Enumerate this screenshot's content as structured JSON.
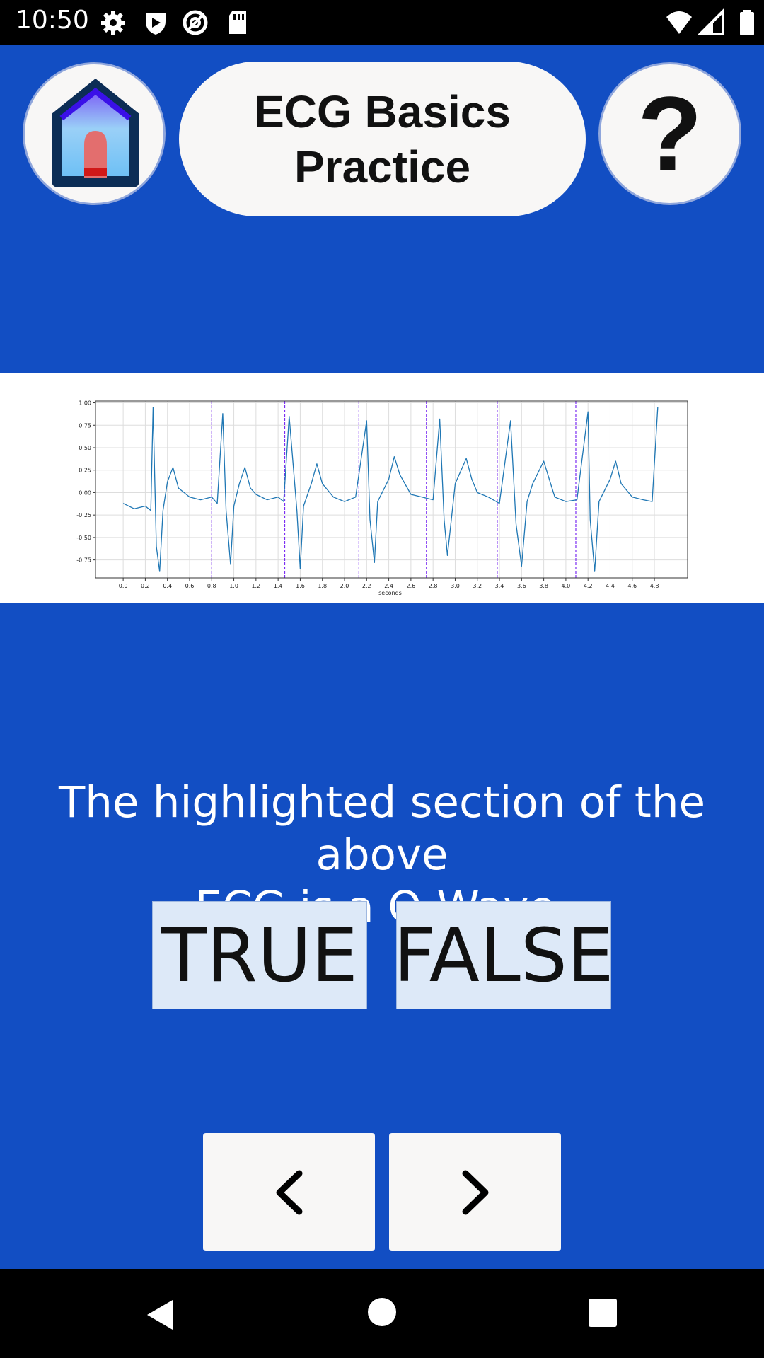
{
  "status_bar": {
    "time": "10:50",
    "left_icons": [
      "settings-icon",
      "shield-icon",
      "at-sign-icon",
      "sd-card-icon"
    ],
    "right_icons": [
      "wifi-icon",
      "signal-icon",
      "battery-icon"
    ]
  },
  "header": {
    "home_icon": "home-icon",
    "title_line1": "ECG Basics",
    "title_line2": "Practice",
    "help_label": "?"
  },
  "chart_data": {
    "type": "line",
    "title": "",
    "xlabel": "seconds",
    "ylabel": "",
    "xlim": [
      -0.25,
      5.1
    ],
    "ylim": [
      -0.95,
      1.02
    ],
    "x_ticks": [
      "0.0",
      "0.2",
      "0.4",
      "0.6",
      "0.8",
      "1.0",
      "1.2",
      "1.4",
      "1.6",
      "1.8",
      "2.0",
      "2.2",
      "2.4",
      "2.6",
      "2.8",
      "3.0",
      "3.2",
      "3.4",
      "3.6",
      "3.8",
      "4.0",
      "4.2",
      "4.4",
      "4.6",
      "4.8"
    ],
    "y_ticks": [
      "1.00",
      "0.75",
      "0.50",
      "0.25",
      "0.00",
      "-0.25",
      "-0.50",
      "-0.75"
    ],
    "grid": true,
    "series_color": "#1f77b4",
    "highlight_color": "#7b2df2",
    "highlight_lines_x": [
      0.8,
      1.46,
      2.13,
      2.74,
      3.38,
      4.09
    ],
    "x": [
      0.0,
      0.1,
      0.2,
      0.25,
      0.27,
      0.3,
      0.33,
      0.36,
      0.4,
      0.45,
      0.5,
      0.55,
      0.6,
      0.7,
      0.8,
      0.85,
      0.9,
      0.93,
      0.97,
      1.0,
      1.05,
      1.1,
      1.15,
      1.2,
      1.3,
      1.4,
      1.45,
      1.5,
      1.57,
      1.6,
      1.63,
      1.7,
      1.75,
      1.8,
      1.9,
      2.0,
      2.1,
      2.2,
      2.23,
      2.27,
      2.3,
      2.4,
      2.45,
      2.5,
      2.6,
      2.7,
      2.8,
      2.86,
      2.9,
      2.93,
      3.0,
      3.1,
      3.15,
      3.2,
      3.3,
      3.4,
      3.5,
      3.55,
      3.6,
      3.65,
      3.7,
      3.8,
      3.85,
      3.9,
      4.0,
      4.1,
      4.2,
      4.22,
      4.26,
      4.3,
      4.4,
      4.45,
      4.5,
      4.6,
      4.7,
      4.78,
      4.83
    ],
    "y": [
      -0.12,
      -0.18,
      -0.15,
      -0.2,
      0.95,
      -0.6,
      -0.88,
      -0.2,
      0.12,
      0.28,
      0.05,
      0.0,
      -0.05,
      -0.08,
      -0.05,
      -0.12,
      0.88,
      -0.2,
      -0.8,
      -0.15,
      0.1,
      0.28,
      0.05,
      -0.02,
      -0.08,
      -0.05,
      -0.1,
      0.85,
      -0.2,
      -0.85,
      -0.15,
      0.1,
      0.32,
      0.1,
      -0.05,
      -0.1,
      -0.05,
      0.8,
      -0.3,
      -0.78,
      -0.1,
      0.15,
      0.4,
      0.2,
      -0.02,
      -0.05,
      -0.08,
      0.82,
      -0.3,
      -0.7,
      0.1,
      0.38,
      0.15,
      0.0,
      -0.05,
      -0.12,
      0.8,
      -0.35,
      -0.82,
      -0.1,
      0.1,
      0.35,
      0.15,
      -0.05,
      -0.1,
      -0.08,
      0.9,
      -0.3,
      -0.88,
      -0.1,
      0.15,
      0.35,
      0.1,
      -0.05,
      -0.08,
      -0.1,
      0.95
    ]
  },
  "question": {
    "line1": "The highlighted section of the above",
    "line2": "ECG is a Q-Wave."
  },
  "answers": {
    "true_label": "TRUE",
    "false_label": "FALSE"
  },
  "navigation": {
    "prev_icon": "chevron-left-icon",
    "next_icon": "chevron-right-icon"
  },
  "system_nav": {
    "back_icon": "back-triangle-icon",
    "home_icon": "home-circle-icon",
    "recents_icon": "recents-square-icon"
  }
}
